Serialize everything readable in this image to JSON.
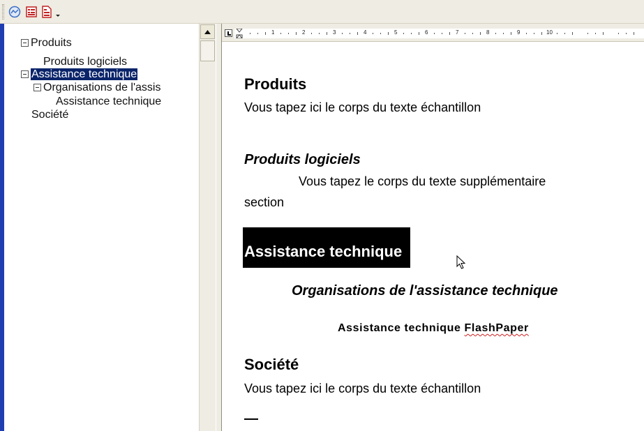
{
  "toolbar": {
    "buttons": [
      {
        "icon": "navigation-icon"
      },
      {
        "icon": "headings-icon"
      },
      {
        "icon": "document-icon"
      }
    ],
    "dropdown_icon": "dropdown-arrow-icon"
  },
  "outline": {
    "items": [
      {
        "label": "Produits",
        "level": 0,
        "expandable": true,
        "selected": false
      },
      {
        "label": "Produits logiciels",
        "level": 1,
        "expandable": false,
        "selected": false
      },
      {
        "label": "Assistance technique",
        "level": 0,
        "expandable": true,
        "selected": true
      },
      {
        "label": "Organisations de l'assis",
        "level": 1,
        "expandable": true,
        "selected": false
      },
      {
        "label": "Assistance technique",
        "level": 2,
        "expandable": false,
        "selected": false
      },
      {
        "label": "Société",
        "level": 0,
        "expandable": false,
        "selected": false
      }
    ]
  },
  "ruler": {
    "numbers": [
      "1",
      "2",
      "3",
      "4",
      "5",
      "6",
      "7",
      "8",
      "9",
      "10"
    ]
  },
  "document": {
    "s1_heading": "Produits",
    "s1_body": "Vous tapez ici le corps du texte échantillon",
    "s2_heading": "Produits logiciels",
    "s2_body_line1": "Vous tapez le corps du texte supplémentaire",
    "s2_body_line2": "section",
    "s3_heading": "Assistance technique",
    "s3_sub": "Organisations de l'assistance technique",
    "s3_sub2_part1": "Assistance technique ",
    "s3_sub2_part2": "FlashPaper",
    "s4_heading": "Société",
    "s4_body": "Vous tapez ici le corps du texte échantillon"
  },
  "colors": {
    "selection_outline": "#0a246a",
    "selection_doc": "#000000",
    "left_border": "#1f3fb1",
    "chrome": "#efece3"
  }
}
